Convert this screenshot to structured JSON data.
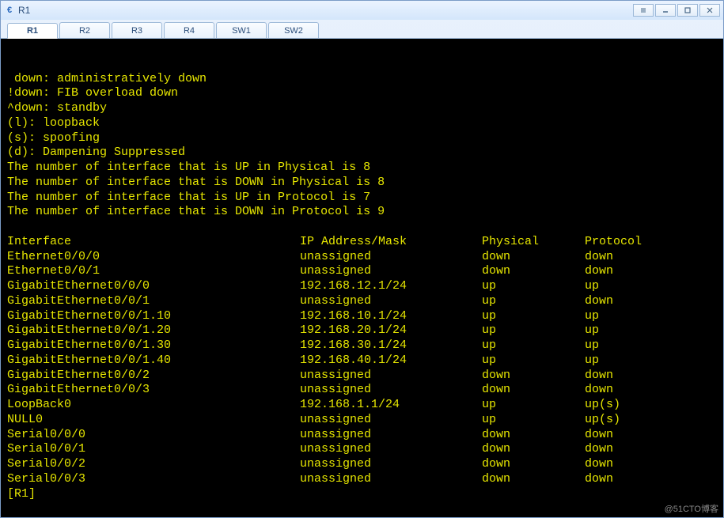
{
  "window": {
    "title": "R1",
    "icon_label": "€"
  },
  "tabs": [
    {
      "label": "R1",
      "active": true
    },
    {
      "label": "R2",
      "active": false
    },
    {
      "label": "R3",
      "active": false
    },
    {
      "label": "R4",
      "active": false
    },
    {
      "label": "SW1",
      "active": false
    },
    {
      "label": "SW2",
      "active": false
    }
  ],
  "terminal": {
    "header_lines": [
      " down: administratively down",
      "!down: FIB overload down",
      "^down: standby",
      "(l): loopback",
      "(s): spoofing",
      "(d): Dampening Suppressed",
      "The number of interface that is UP in Physical is 8",
      "The number of interface that is DOWN in Physical is 8",
      "The number of interface that is UP in Protocol is 7",
      "The number of interface that is DOWN in Protocol is 9",
      ""
    ],
    "columns": {
      "iface": "Interface",
      "ip": "IP Address/Mask",
      "phy": "Physical",
      "proto": "Protocol"
    },
    "rows": [
      {
        "iface": "Ethernet0/0/0",
        "ip": "unassigned",
        "phy": "down",
        "proto": "down"
      },
      {
        "iface": "Ethernet0/0/1",
        "ip": "unassigned",
        "phy": "down",
        "proto": "down"
      },
      {
        "iface": "GigabitEthernet0/0/0",
        "ip": "192.168.12.1/24",
        "phy": "up",
        "proto": "up"
      },
      {
        "iface": "GigabitEthernet0/0/1",
        "ip": "unassigned",
        "phy": "up",
        "proto": "down"
      },
      {
        "iface": "GigabitEthernet0/0/1.10",
        "ip": "192.168.10.1/24",
        "phy": "up",
        "proto": "up"
      },
      {
        "iface": "GigabitEthernet0/0/1.20",
        "ip": "192.168.20.1/24",
        "phy": "up",
        "proto": "up"
      },
      {
        "iface": "GigabitEthernet0/0/1.30",
        "ip": "192.168.30.1/24",
        "phy": "up",
        "proto": "up"
      },
      {
        "iface": "GigabitEthernet0/0/1.40",
        "ip": "192.168.40.1/24",
        "phy": "up",
        "proto": "up"
      },
      {
        "iface": "GigabitEthernet0/0/2",
        "ip": "unassigned",
        "phy": "down",
        "proto": "down"
      },
      {
        "iface": "GigabitEthernet0/0/3",
        "ip": "unassigned",
        "phy": "down",
        "proto": "down"
      },
      {
        "iface": "LoopBack0",
        "ip": "192.168.1.1/24",
        "phy": "up",
        "proto": "up(s)"
      },
      {
        "iface": "NULL0",
        "ip": "unassigned",
        "phy": "up",
        "proto": "up(s)"
      },
      {
        "iface": "Serial0/0/0",
        "ip": "unassigned",
        "phy": "down",
        "proto": "down"
      },
      {
        "iface": "Serial0/0/1",
        "ip": "unassigned",
        "phy": "down",
        "proto": "down"
      },
      {
        "iface": "Serial0/0/2",
        "ip": "unassigned",
        "phy": "down",
        "proto": "down"
      },
      {
        "iface": "Serial0/0/3",
        "ip": "unassigned",
        "phy": "down",
        "proto": "down"
      }
    ],
    "prompt": "[R1]"
  },
  "watermark": "@51CTO博客"
}
